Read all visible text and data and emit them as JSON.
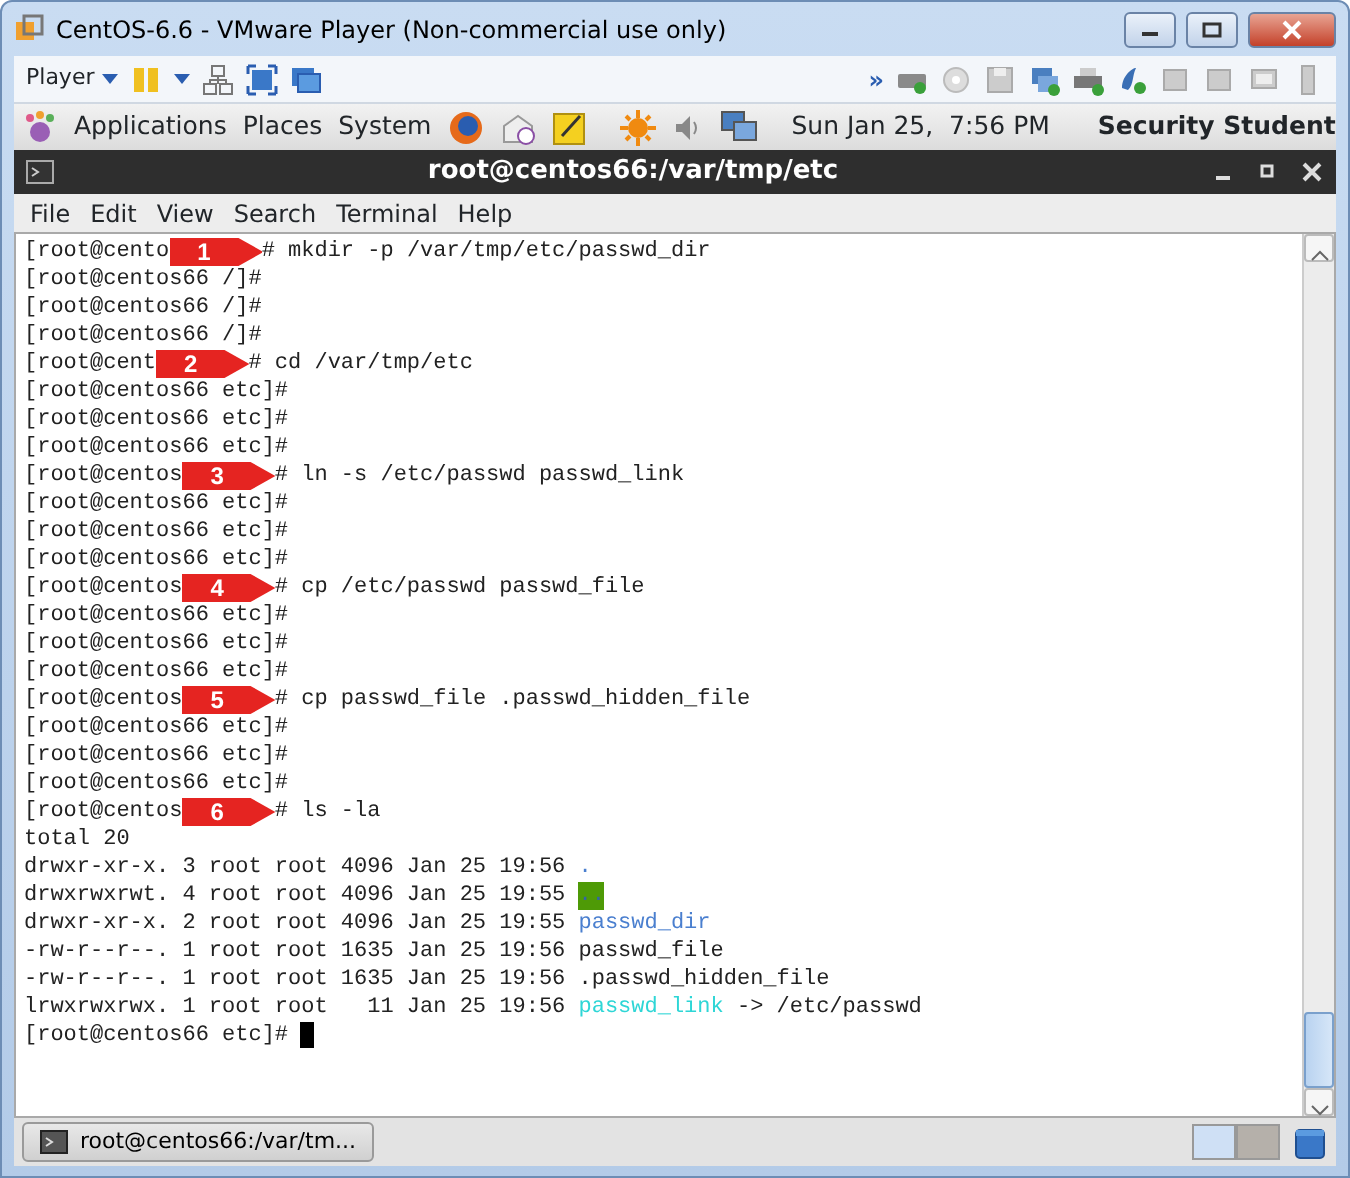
{
  "window": {
    "title": "CentOS-6.6 - VMware Player (Non-commercial use only)"
  },
  "player_toolbar": {
    "menu": "Player",
    "overflow": "»"
  },
  "panel": {
    "menus": [
      "Applications",
      "Places",
      "System"
    ],
    "clock": "Sun Jan 25,  7:56 PM",
    "user": "Security Student"
  },
  "terminal": {
    "title": "root@centos66:/var/tmp/etc",
    "menu": [
      "File",
      "Edit",
      "View",
      "Search",
      "Terminal",
      "Help"
    ],
    "lines": [
      {
        "kind": "annotated",
        "before": "[root@cento",
        "marker": "1",
        "after": "# mkdir -p /var/tmp/etc/passwd_dir"
      },
      {
        "kind": "plain",
        "text": "[root@centos66 /]#"
      },
      {
        "kind": "plain",
        "text": "[root@centos66 /]#"
      },
      {
        "kind": "plain",
        "text": "[root@centos66 /]#"
      },
      {
        "kind": "annotated",
        "before": "[root@cent",
        "marker": "2",
        "after": "# cd /var/tmp/etc"
      },
      {
        "kind": "plain",
        "text": "[root@centos66 etc]#"
      },
      {
        "kind": "plain",
        "text": "[root@centos66 etc]#"
      },
      {
        "kind": "plain",
        "text": "[root@centos66 etc]#"
      },
      {
        "kind": "annotated",
        "before": "[root@centos",
        "marker": "3",
        "after": "# ln -s /etc/passwd passwd_link"
      },
      {
        "kind": "plain",
        "text": "[root@centos66 etc]#"
      },
      {
        "kind": "plain",
        "text": "[root@centos66 etc]#"
      },
      {
        "kind": "plain",
        "text": "[root@centos66 etc]#"
      },
      {
        "kind": "annotated",
        "before": "[root@centos",
        "marker": "4",
        "after": "# cp /etc/passwd passwd_file"
      },
      {
        "kind": "plain",
        "text": "[root@centos66 etc]#"
      },
      {
        "kind": "plain",
        "text": "[root@centos66 etc]#"
      },
      {
        "kind": "plain",
        "text": "[root@centos66 etc]#"
      },
      {
        "kind": "annotated",
        "before": "[root@centos",
        "marker": "5",
        "after": "# cp passwd_file .passwd_hidden_file"
      },
      {
        "kind": "plain",
        "text": "[root@centos66 etc]#"
      },
      {
        "kind": "plain",
        "text": "[root@centos66 etc]#"
      },
      {
        "kind": "plain",
        "text": "[root@centos66 etc]#"
      },
      {
        "kind": "annotated",
        "before": "[root@centos",
        "marker": "6",
        "after": "# ls -la"
      },
      {
        "kind": "plain",
        "text": "total 20"
      },
      {
        "kind": "listing",
        "info": "drwxr-xr-x. 3 root root 4096 Jan 25 19:56",
        "name": ".",
        "color": "#4a7fcf"
      },
      {
        "kind": "listing",
        "info": "drwxrwxrwt. 4 root root 4096 Jan 25 19:55",
        "name": "..",
        "color": "#4e9a06",
        "highlighted": true
      },
      {
        "kind": "listing",
        "info": "drwxr-xr-x. 2 root root 4096 Jan 25 19:55",
        "name": "passwd_dir",
        "color": "#4a7fcf"
      },
      {
        "kind": "listing",
        "info": "-rw-r--r--. 1 root root 1635 Jan 25 19:56",
        "name": "passwd_file"
      },
      {
        "kind": "listing",
        "info": "-rw-r--r--. 1 root root 1635 Jan 25 19:56",
        "name": ".passwd_hidden_file"
      },
      {
        "kind": "listing",
        "info": "lrwxrwxrwx. 1 root root   11 Jan 25 19:56",
        "name": "passwd_link",
        "color": "#2ed6d6",
        "target": "-> /etc/passwd"
      },
      {
        "kind": "cursor",
        "text": "[root@centos66 etc]#"
      }
    ]
  },
  "taskbar": {
    "tasks": [
      {
        "label": "root@centos66:/var/tm..."
      }
    ],
    "workspaces": [
      {
        "selected": true
      },
      {
        "selected": false
      }
    ]
  }
}
